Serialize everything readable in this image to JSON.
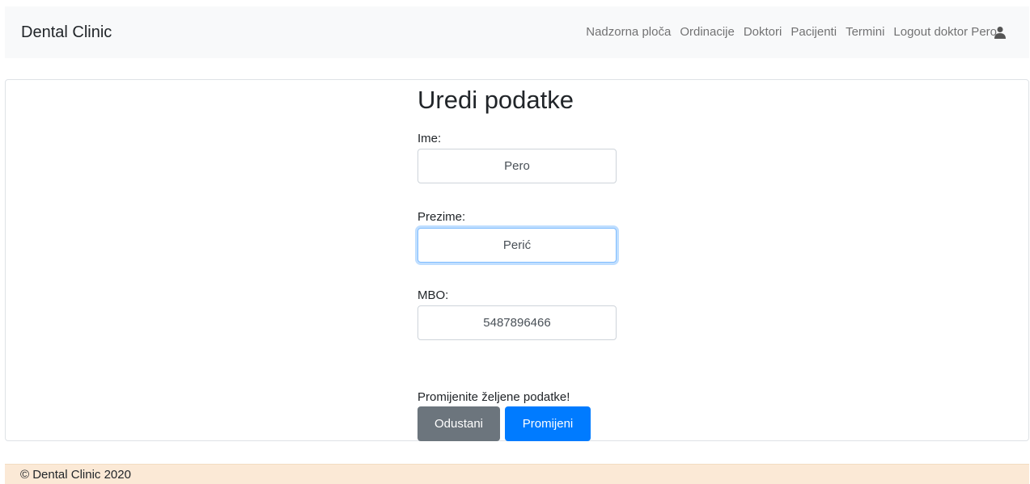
{
  "navbar": {
    "brand": "Dental Clinic",
    "links": [
      "Nadzorna ploča",
      "Ordinacije",
      "Doktori",
      "Pacijenti",
      "Termini",
      "Logout doktor Pero"
    ],
    "user_icon": "user-icon"
  },
  "form": {
    "title": "Uredi podatke",
    "ime_label": "Ime:",
    "ime_value": "Pero",
    "prezime_label": "Prezime:",
    "prezime_value": "Perić",
    "mbo_label": "MBO:",
    "mbo_value": "5487896466",
    "hint": "Promijenite željene podatke!",
    "cancel_label": "Odustani",
    "submit_label": "Promijeni"
  },
  "footer": {
    "text": "© Dental Clinic 2020"
  },
  "colors": {
    "primary": "#007bff",
    "secondary": "#6c757d",
    "navbar_bg": "#f8f9fa",
    "footer_bg": "#fbe9d6"
  }
}
